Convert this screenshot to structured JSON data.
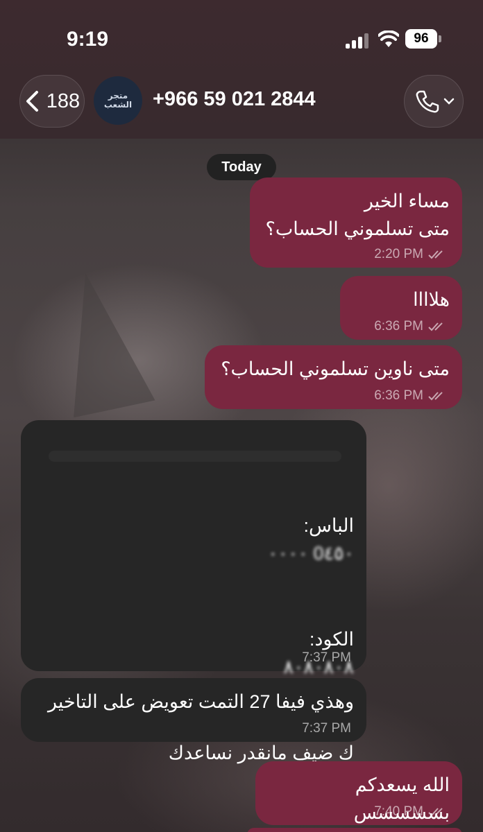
{
  "status_bar": {
    "time": "9:19",
    "battery": "96"
  },
  "header": {
    "back_count": "188",
    "avatar_line1": "متجر",
    "avatar_line2": "الشعب",
    "contact": "+966 59 021 2844"
  },
  "date_separator": "Today",
  "messages": [
    {
      "direction": "outgoing",
      "text": "مساء الخير\nمتى تسلموني الحساب؟",
      "time": "2:20 PM",
      "read": true
    },
    {
      "direction": "outgoing",
      "text": "هلاااا",
      "time": "6:36 PM",
      "read": true
    },
    {
      "direction": "outgoing",
      "text": "متى ناوين تسلموني الحساب؟",
      "time": "6:36 PM",
      "read": true
    },
    {
      "direction": "incoming",
      "pass_label": "الباس:",
      "pass_value": "0٤٥٠ ٠٠٠٠",
      "code_label": "الكود:",
      "code_value": "٨٠٨٠٨٠٨",
      "text": "لاتسجل دخول ك ضيف اذا سجلت دخول ك ضيف مانقدر نساعدك",
      "time": "7:37 PM"
    },
    {
      "direction": "incoming",
      "text": "وهذي فيفا 27 التمت تعويض على التاخير",
      "time": "7:37 PM"
    },
    {
      "direction": "outgoing",
      "text": "الله يسعدكم بسسسسس",
      "time": "7:40 PM",
      "read": true
    }
  ],
  "colors": {
    "outgoing_bubble": "#7a2740",
    "incoming_bubble": "#262626",
    "header_bg": "#3d2a2f"
  },
  "icons": [
    "back-chevron-icon",
    "phone-icon",
    "chevron-down-icon",
    "double-check-icon",
    "signal-icon",
    "wifi-icon",
    "battery-icon"
  ]
}
